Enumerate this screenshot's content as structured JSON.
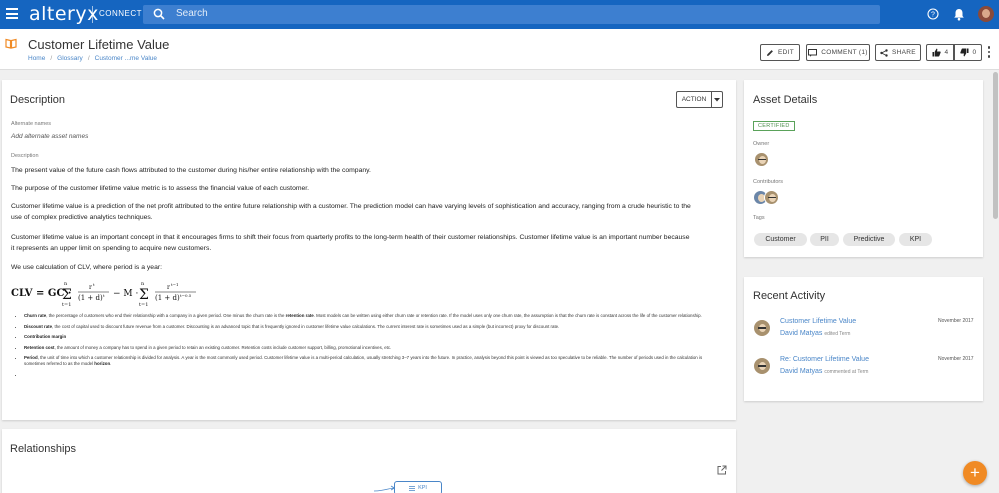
{
  "topbar": {
    "brand": "alteryx",
    "product": "CONNECT",
    "search_placeholder": "Search"
  },
  "header": {
    "title": "Customer Lifetime Value",
    "breadcrumb": [
      "Home",
      "Glossary",
      "Customer ...me Value"
    ],
    "buttons": {
      "edit": "EDIT",
      "comment": "COMMENT (1)",
      "share": "SHARE",
      "likes": "4",
      "dislikes": "0"
    }
  },
  "description": {
    "title": "Description",
    "action_label": "ACTION",
    "alternate_names_label": "Alternate names",
    "alternate_names_value": "Add alternate asset names",
    "description_label": "Description",
    "paragraphs": [
      "The present value of the future cash flows attributed to the customer during his/her entire relationship with the company.",
      "The purpose of the customer lifetime value metric is to assess the financial value of each customer.",
      "Customer lifetime value is a prediction of the net profit attributed to the entire future relationship with a customer. The prediction model can have varying levels of sophistication and accuracy, ranging from a crude heuristic to the use of complex predictive analytics techniques.",
      "Customer lifetime value is an important concept in that it encourages firms to shift their focus from quarterly profits to the long-term health of their customer relationships. Customer lifetime value is an important number because it represents an upper limit on spending to acquire new customers.",
      "We use calculation of CLV, where period is a year:"
    ],
    "bullets": [
      {
        "term": "Churn rate",
        "text": ", the percentage of customers who end their relationship with a company in a given period. One minus the churn rate is the ",
        "term2": "retention rate",
        "text2": ". Most models can be written using either churn rate or retention rate. If the model uses only one churn rate, the assumption is that the churn rate is constant across the life of the customer relationship."
      },
      {
        "term": "Discount rate",
        "text": ", the cost of capital used to discount future revenue from a customer. Discounting is an advanced topic that is frequently ignored in customer lifetime value calculations. The current interest rate is sometimes used as a simple (but incorrect) proxy for discount rate.",
        "term2": "",
        "text2": ""
      },
      {
        "term": "Contribution margin",
        "text": "",
        "term2": "",
        "text2": ""
      },
      {
        "term": "Retention cost",
        "text": ", the amount of money a company has to spend in a given period to retain an existing customer. Retention costs include customer support, billing, promotional incentives, etc.",
        "term2": "",
        "text2": ""
      },
      {
        "term": "Period",
        "text": ", the unit of time into which a customer relationship is divided for analysis. A year is the most commonly used period. Customer lifetime value is a multi-period calculation, usually stretching 3–7 years into the future. In practice, analysis beyond this point is viewed as too speculative to be reliable. The number of periods used in the calculation is sometimes referred to as the model ",
        "term2": "horizon",
        "text2": "."
      }
    ]
  },
  "asset_details": {
    "title": "Asset Details",
    "certified": "CERTIFIED",
    "owner_label": "Owner",
    "contributors_label": "Contributors",
    "tags_label": "Tags",
    "tags": [
      "Customer",
      "PII",
      "Predictive",
      "KPI"
    ]
  },
  "recent_activity": {
    "title": "Recent Activity",
    "items": [
      {
        "link": "Customer Lifetime Value",
        "user": "David Matyas",
        "action": "edited Term",
        "date": "November 2017"
      },
      {
        "link": "Re: Customer Lifetime Value",
        "user": "David Matyas",
        "action": "commented at Term",
        "date": "November 2017"
      }
    ]
  },
  "relationships": {
    "title": "Relationships",
    "node_label": "KPI"
  },
  "colors": {
    "topbar": "#1565c0",
    "search": "#3d7fd0",
    "link": "#4a86c8",
    "certified": "#5aa25a",
    "fab": "#f08a24"
  }
}
